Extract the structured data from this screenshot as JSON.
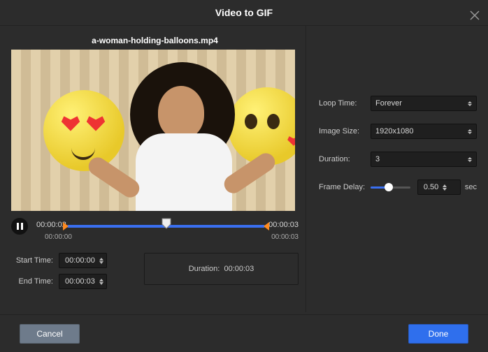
{
  "title": "Video to GIF",
  "filename": "a-woman-holding-balloons.mp4",
  "timeline": {
    "current": "00:00:02",
    "total": "00:00:03",
    "range_start": "00:00:00",
    "range_end": "00:00:03"
  },
  "inputs": {
    "start_label": "Start Time:",
    "start_value": "00:00:00",
    "end_label": "End Time:",
    "end_value": "00:00:03",
    "duration_label": "Duration:",
    "duration_value": "00:00:03"
  },
  "settings": {
    "loop_label": "Loop Time:",
    "loop_value": "Forever",
    "size_label": "Image Size:",
    "size_value": "1920x1080",
    "dur_label": "Duration:",
    "dur_value": "3",
    "delay_label": "Frame Delay:",
    "delay_value": "0.50",
    "delay_unit": "sec",
    "delay_fraction": 0.45
  },
  "buttons": {
    "cancel": "Cancel",
    "done": "Done"
  }
}
